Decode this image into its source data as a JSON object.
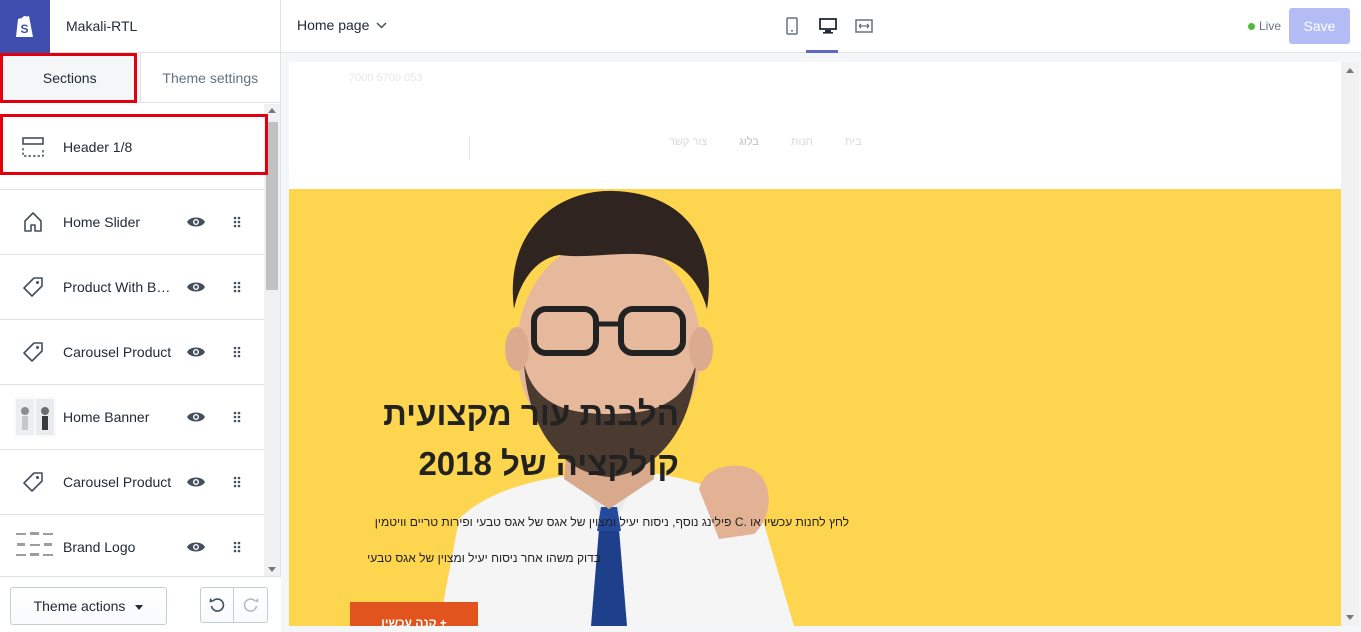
{
  "app": {
    "store_name": "Makali-RTL"
  },
  "sidebar": {
    "tabs": [
      {
        "label": "Sections"
      },
      {
        "label": "Theme settings"
      }
    ],
    "sections": [
      {
        "label": "Header 1/8",
        "icon": "header-layout-icon"
      },
      {
        "label": "Home Slider",
        "icon": "home-icon"
      },
      {
        "label": "Product With Ba…",
        "icon": "tag-icon"
      },
      {
        "label": "Carousel Product",
        "icon": "tag-icon"
      },
      {
        "label": "Home Banner",
        "icon": "banner-thumbnail"
      },
      {
        "label": "Carousel Product",
        "icon": "tag-icon"
      },
      {
        "label": "Brand Logo",
        "icon": "brand-logo-thumbnail"
      }
    ],
    "footer": {
      "theme_actions_label": "Theme actions"
    }
  },
  "topbar": {
    "page_select": "Home page",
    "status": "Live",
    "save_label": "Save",
    "accent": "#5c6ac4",
    "status_color": "#50b83c"
  },
  "preview": {
    "topline": "7000 5700 053",
    "nav": [
      "בית",
      "חנות",
      "בלוג",
      "צור קשר"
    ],
    "hero": {
      "title_line1": "הלבנת עור מקצועית",
      "title_line2": "קולקציה של 2018",
      "subtitle": "לחץ לחנות עכשיו או .C פילינג נוסף, ניסוח יעיל ומצוין של אגס של אגס טבעי ופירות טריים וויטמין",
      "subtitle2": "בדוק משהו אחר ניסוח יעיל ומצוין של אגס טבעי",
      "button_label": "+ קנה עכשיו",
      "background": "#fdd54f",
      "button_color": "#e2541d"
    }
  }
}
